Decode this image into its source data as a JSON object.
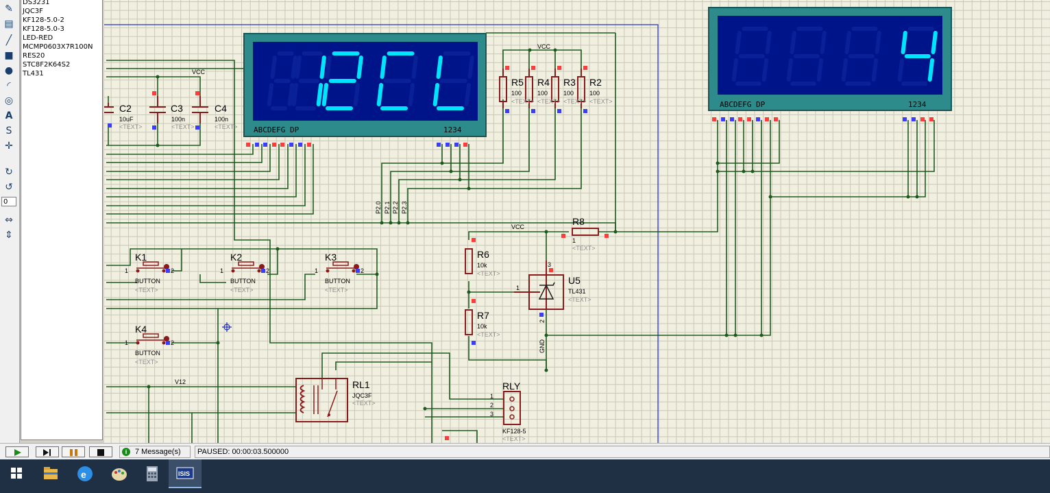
{
  "devices": [
    "DS3231",
    "JQC3F",
    "KF128-5.0-2",
    "KF128-5.0-3",
    "LED-RED",
    "MCMP0603X7R100N",
    "RES20",
    "STC8F2K64S2",
    "TL431"
  ],
  "rotation_value": "0",
  "display1": {
    "digits": [
      "8",
      "1",
      "2",
      "C",
      "L"
    ],
    "pin_labels": "ABCDEFG DP",
    "digit_labels": "1234"
  },
  "display2": {
    "pin_labels": "ABCDEFG DP",
    "digit_labels": "1234",
    "shown": "4"
  },
  "components": {
    "c2": {
      "ref": "C2",
      "value": "10uF",
      "text": "<TEXT>"
    },
    "c3": {
      "ref": "C3",
      "value": "100n",
      "text": "<TEXT>"
    },
    "c4": {
      "ref": "C4",
      "value": "100n",
      "text": "<TEXT>"
    },
    "r5": {
      "ref": "R5",
      "value": "100",
      "text": "<TEXT>"
    },
    "r4": {
      "ref": "R4",
      "value": "100",
      "text": "<TEXT>"
    },
    "r3": {
      "ref": "R3",
      "value": "100",
      "text": "<TEXT>"
    },
    "r2": {
      "ref": "R2",
      "value": "100",
      "text": "<TEXT>"
    },
    "r6": {
      "ref": "R6",
      "value": "10k",
      "text": "<TEXT>"
    },
    "r7": {
      "ref": "R7",
      "value": "10k",
      "text": "<TEXT>"
    },
    "r8": {
      "ref": "R8",
      "value": "1",
      "text": "<TEXT>"
    },
    "u5": {
      "ref": "U5",
      "value": "TL431",
      "text": "<TEXT>",
      "pin1": "1",
      "pin2": "2",
      "pin3": "3"
    },
    "k1": {
      "ref": "K1",
      "value": "BUTTON",
      "text": "<TEXT>"
    },
    "k2": {
      "ref": "K2",
      "value": "BUTTON",
      "text": "<TEXT>"
    },
    "k3": {
      "ref": "K3",
      "value": "BUTTON",
      "text": "<TEXT>"
    },
    "k4": {
      "ref": "K4",
      "value": "BUTTON",
      "text": "<TEXT>"
    },
    "rl1": {
      "ref": "RL1",
      "value": "JQC3F",
      "text": "<TEXT>"
    },
    "rly": {
      "ref": "RLY",
      "value": "KF128-5",
      "text": "<TEXT>",
      "pins": [
        "1",
        "2",
        "3"
      ]
    }
  },
  "nets": {
    "vcc": "VCC",
    "v12": "V12",
    "gnd": "GND",
    "p20": "P2.0",
    "p21": "P2.1",
    "p22": "P2.2",
    "p23": "P2.3"
  },
  "pin_numbers": {
    "one": "1",
    "two": "2"
  },
  "statusbar": {
    "messages": "7 Message(s)",
    "status": "PAUSED: 00:00:03.500000"
  },
  "colors": {
    "wire": "#1e5a1e",
    "component": "#8b1a1a",
    "display_frame": "#2e8b8b",
    "display_bg": "#001489",
    "segment_on": "#00e5ff",
    "segment_off": "#0a2096",
    "pin_red": "#ff3c3c",
    "pin_blue": "#3c3cff"
  }
}
